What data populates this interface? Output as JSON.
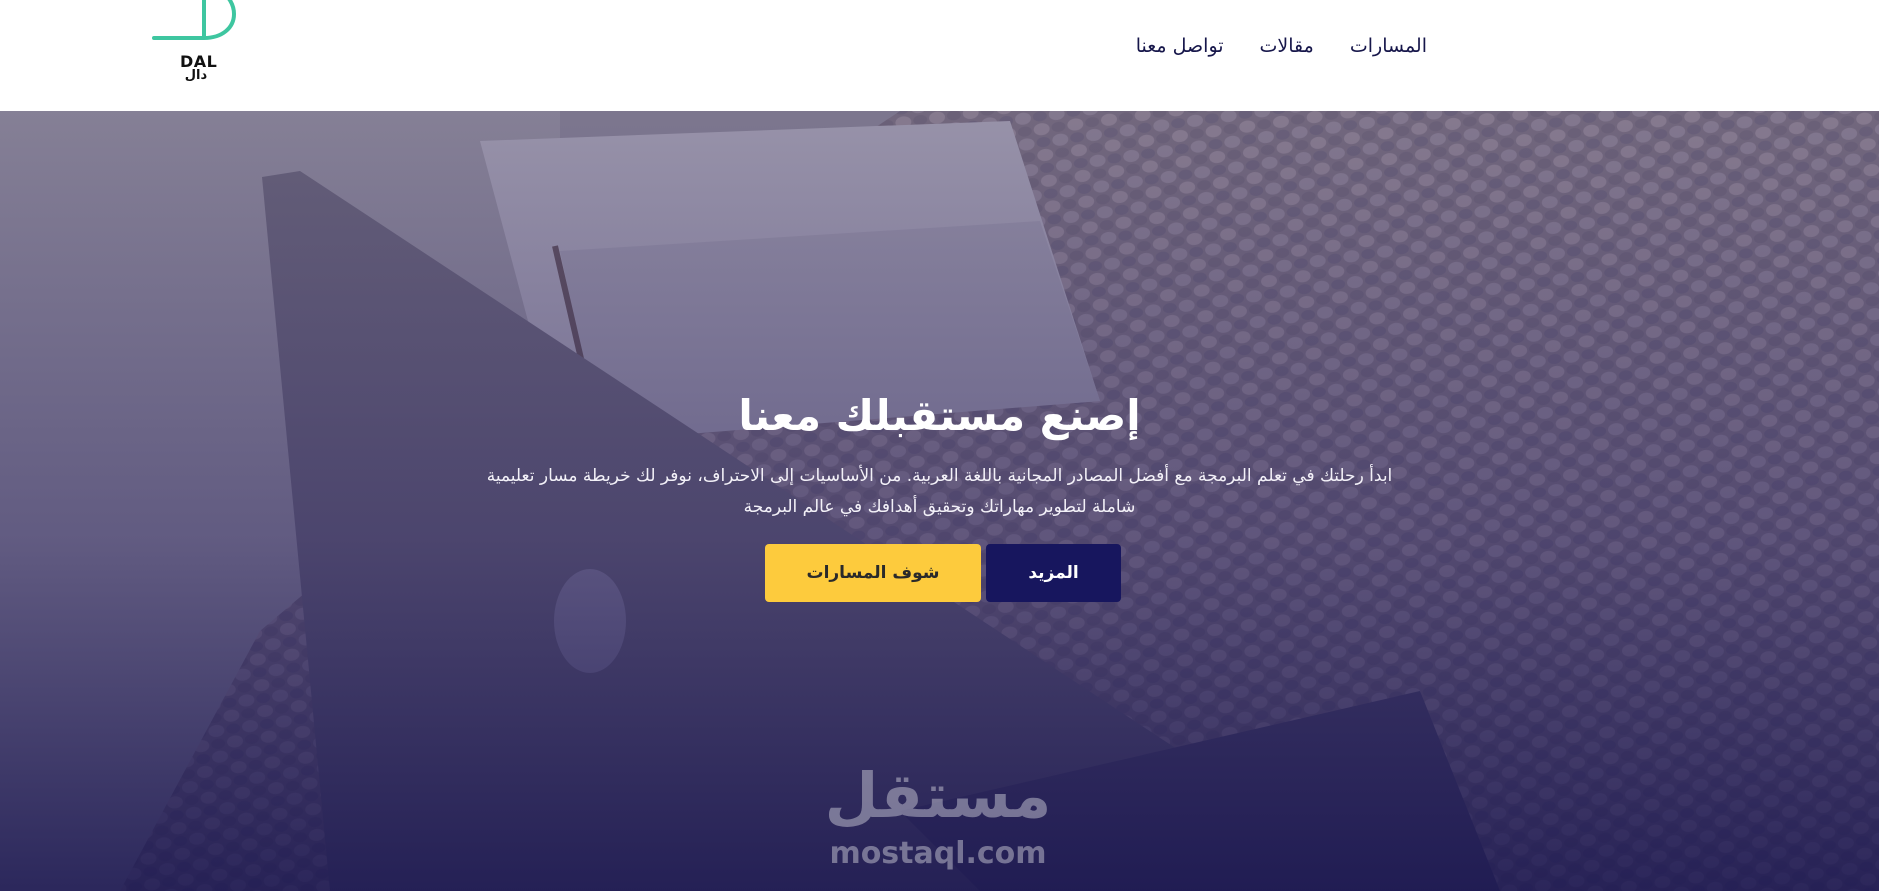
{
  "header": {
    "logo": {
      "text_en": "DAL",
      "text_ar": "دال",
      "accent_color": "#3ec6a0"
    },
    "nav": [
      {
        "label": "تواصل معنا"
      },
      {
        "label": "مقالات"
      },
      {
        "label": "المسارات"
      }
    ]
  },
  "hero": {
    "title": "إصنع مستقبلك معنا",
    "description": "ابدأ رحلتك في تعلم البرمجة مع أفضل المصادر المجانية باللغة العربية. من الأساسيات إلى الاحتراف، نوفر لك خريطة مسار تعليمية شاملة لتطوير مهاراتك وتحقيق أهدافك في عالم البرمجة",
    "buttons": {
      "more": "المزيد",
      "tracks": "شوف المسارات"
    },
    "colors": {
      "primary": "#17165e",
      "accent": "#fdcb3d"
    }
  },
  "watermark": {
    "text_ar": "مستقل",
    "text_en": "mostaql.com"
  }
}
